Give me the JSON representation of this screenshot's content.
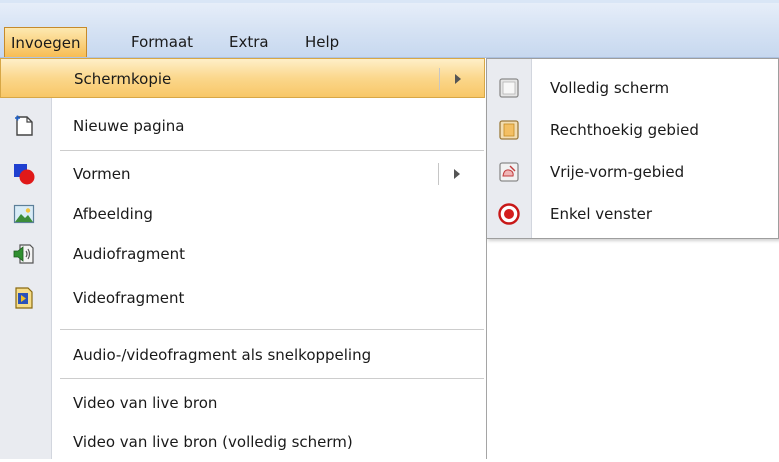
{
  "menubar": {
    "items": [
      {
        "label": "Invoegen"
      },
      {
        "label": "Formaat"
      },
      {
        "label": "Extra"
      },
      {
        "label": "Help"
      }
    ]
  },
  "menu": {
    "items": [
      {
        "label": "Schermkopie",
        "icon": "none",
        "has_submenu": true,
        "highlighted": true
      },
      {
        "label": "Nieuwe pagina",
        "icon": "new-page-icon"
      },
      {
        "label": "Vormen",
        "icon": "shapes-icon",
        "has_submenu": true
      },
      {
        "label": "Afbeelding",
        "icon": "picture-icon"
      },
      {
        "label": "Audiofragment",
        "icon": "audio-icon"
      },
      {
        "label": "Videofragment",
        "icon": "video-icon"
      },
      {
        "label": "Audio-/videofragment als snelkoppeling",
        "icon": "none"
      },
      {
        "label": "Video van live bron",
        "icon": "none"
      },
      {
        "label": "Video van live bron (volledig scherm)",
        "icon": "none"
      }
    ]
  },
  "submenu": {
    "items": [
      {
        "label": "Volledig scherm",
        "icon": "full-screen-icon"
      },
      {
        "label": "Rechthoekig gebied",
        "icon": "rectangle-area-icon"
      },
      {
        "label": "Vrije-vorm-gebied",
        "icon": "freeform-area-icon"
      },
      {
        "label": "Enkel venster",
        "icon": "single-window-icon"
      }
    ]
  },
  "colors": {
    "highlight": "#fbd78c",
    "menubar": "#d4e1f3",
    "gutter": "#e9ebf0"
  }
}
